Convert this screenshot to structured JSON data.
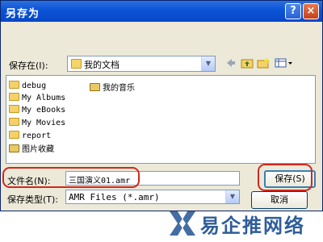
{
  "window": {
    "title": "另存为",
    "help_glyph": "?",
    "close_glyph": "×"
  },
  "toolbar": {
    "save_in_label": "保存在(I):",
    "location_value": "我的文档",
    "icons": [
      "back-icon",
      "up-folder-icon",
      "new-folder-icon",
      "view-menu-icon"
    ]
  },
  "files": [
    {
      "name": "debug",
      "type": "folder"
    },
    {
      "name": "My Albums",
      "type": "folder"
    },
    {
      "name": "My eBooks",
      "type": "folder"
    },
    {
      "name": "My Movies",
      "type": "folder"
    },
    {
      "name": "report",
      "type": "folder"
    },
    {
      "name": "图片收藏",
      "type": "special-folder"
    },
    {
      "name": "我的音乐",
      "type": "special-folder"
    }
  ],
  "filename": {
    "label": "文件名(N):",
    "value": "三国演义01.amr"
  },
  "filetype": {
    "label": "保存类型(T):",
    "value": "AMR Files (*.amr)"
  },
  "buttons": {
    "save": "保存(S)",
    "cancel": "取消"
  },
  "watermark": {
    "text": "易企推网络"
  },
  "colors": {
    "titlebar": "#0a53d6",
    "dialog_bg": "#ece9d8",
    "highlight_oval": "#d0281e",
    "watermark": "#2f5d9a"
  }
}
